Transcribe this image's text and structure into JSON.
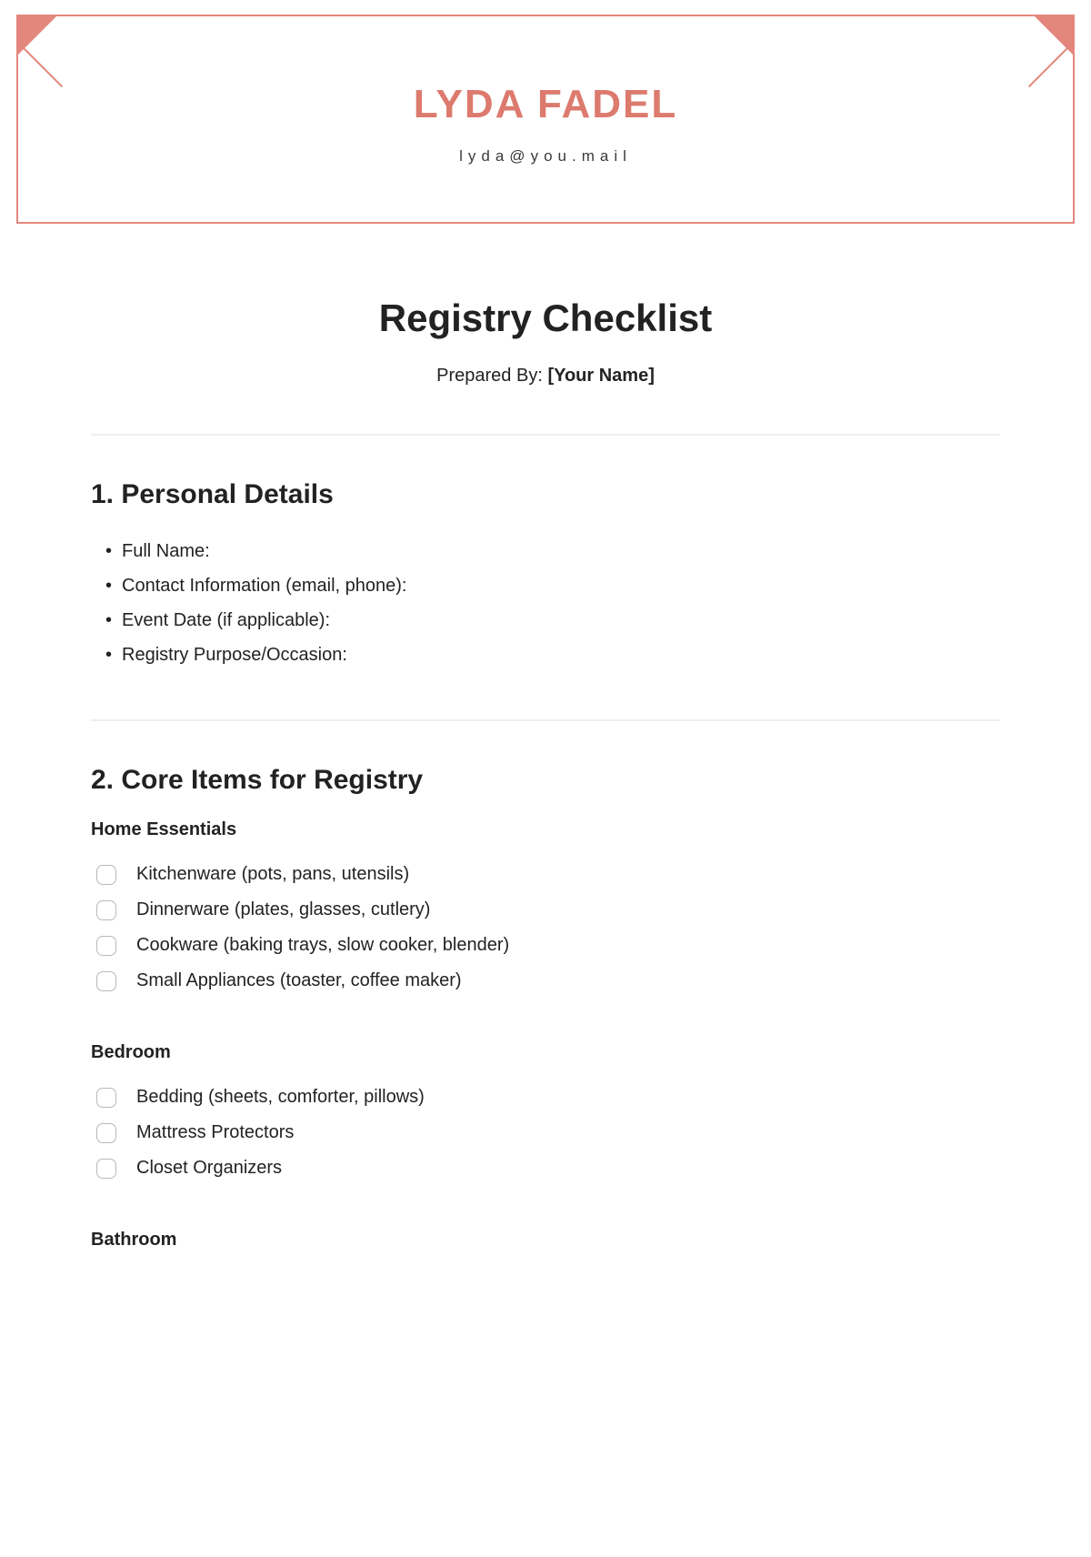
{
  "header": {
    "name": "LYDA FADEL",
    "email": "lyda@you.mail"
  },
  "title": "Registry Checklist",
  "prepared_by_label": "Prepared By: ",
  "prepared_by_value": "[Your Name]",
  "sections": {
    "personal": {
      "heading": "1. Personal Details",
      "items": [
        "Full Name:",
        "Contact Information (email, phone):",
        "Event Date (if applicable):",
        "Registry Purpose/Occasion:"
      ]
    },
    "core": {
      "heading": "2. Core Items for Registry",
      "groups": [
        {
          "title": "Home Essentials",
          "items": [
            "Kitchenware (pots, pans, utensils)",
            "Dinnerware (plates, glasses, cutlery)",
            "Cookware (baking trays, slow cooker, blender)",
            "Small Appliances (toaster, coffee maker)"
          ]
        },
        {
          "title": "Bedroom",
          "items": [
            "Bedding (sheets, comforter, pillows)",
            "Mattress Protectors",
            "Closet Organizers"
          ]
        },
        {
          "title": "Bathroom",
          "items": []
        }
      ]
    }
  }
}
